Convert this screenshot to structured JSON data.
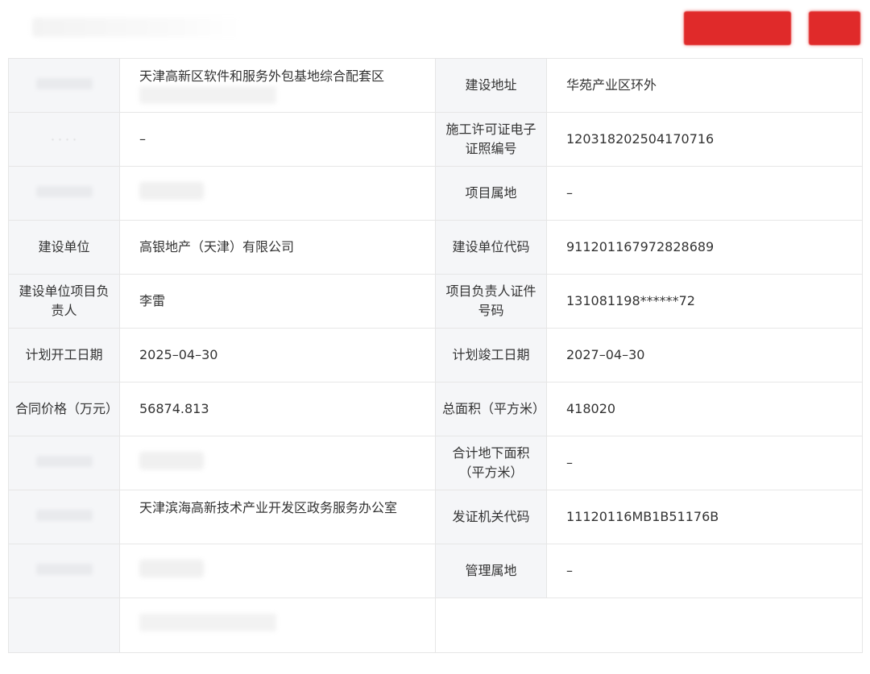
{
  "header": {
    "button_primary_label": "",
    "button_secondary_label": ""
  },
  "rows": [
    {
      "label_left": "",
      "value_left": "天津高新区软件和服务外包基地综合配套区",
      "label_right": "建设地址",
      "value_right": "华苑产业区环外"
    },
    {
      "label_left": "",
      "value_left": "–",
      "label_right": "施工许可证电子证照编号",
      "value_right": "12031820250417071​6"
    },
    {
      "label_left": "",
      "value_left": "",
      "label_right": "项目属地",
      "value_right": "–"
    },
    {
      "label_left": "建设单位",
      "value_left": "高银地产（天津）有限公司",
      "label_right": "建设单位代码",
      "value_right": "911201167972828689"
    },
    {
      "label_left": "建设单位项目负责人",
      "value_left": "李雷",
      "label_right": "项目负责人证件号码",
      "value_right": "131081198******72"
    },
    {
      "label_left": "计划开工日期",
      "value_left": "2025–04–30",
      "label_right": "计划竣工日期",
      "value_right": "2027–04–30"
    },
    {
      "label_left": "合同价格（万元）",
      "value_left": "56874.813",
      "label_right": "总面积（平方米）",
      "value_right": "418020"
    },
    {
      "label_left": "",
      "value_left": "",
      "label_right": "合计地下面积（平方米）",
      "value_right": "–"
    },
    {
      "label_left": "",
      "value_left": "天津滨海高新技术产业开发区政务服务办公室",
      "label_right": "发证机关代码",
      "value_right": "11120116MB1B51176B"
    },
    {
      "label_left": "",
      "value_left": "",
      "label_right": "管理属地",
      "value_right": "–"
    },
    {
      "label_left": "",
      "value_left": "",
      "label_right": "",
      "value_right": ""
    }
  ],
  "colors": {
    "accent_red": "#e02a2a",
    "label_bg": "#f5f6f8",
    "border": "#e6e6e6",
    "text": "#333333"
  }
}
